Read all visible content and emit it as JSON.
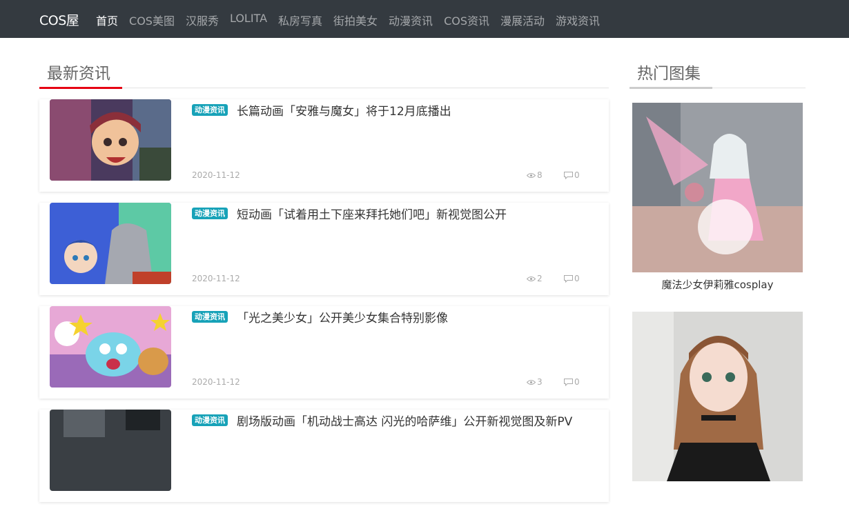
{
  "brand": "COS屋",
  "nav": [
    "首页",
    "COS美图",
    "汉服秀",
    "LOLITA",
    "私房写真",
    "街拍美女",
    "动漫资讯",
    "COS资讯",
    "漫展活动",
    "游戏资讯"
  ],
  "main": {
    "section_title": "最新资讯",
    "accent_color": "#e60012",
    "articles": [
      {
        "tag": "动漫资讯",
        "title": "长篇动画「安雅与魔女」将于12月底播出",
        "date": "2020-11-12",
        "views": "8",
        "comments": "0",
        "thumb_icon": "anime-girl-image"
      },
      {
        "tag": "动漫资讯",
        "title": "短动画「试着用土下座来拜托她们吧」新视觉图公开",
        "date": "2020-11-12",
        "views": "2",
        "comments": "0",
        "thumb_icon": "anime-girls-image"
      },
      {
        "tag": "动漫资讯",
        "title": "「光之美少女」公开美少女集合特别影像",
        "date": "2020-11-12",
        "views": "3",
        "comments": "0",
        "thumb_icon": "precure-mascots-image"
      },
      {
        "tag": "动漫资讯",
        "title": "剧场版动画「机动战士高达 闪光的哈萨维」公开新视觉图及新PV",
        "date": "",
        "views": "",
        "comments": "",
        "thumb_icon": "gundam-image"
      }
    ]
  },
  "side": {
    "section_title": "热门图集",
    "items": [
      {
        "caption": "魔法少女伊莉雅cosplay",
        "icon": "cosplay-photo"
      },
      {
        "caption": "",
        "icon": "cosplay-portrait-photo"
      }
    ]
  },
  "colors": {
    "navbar": "#343a40",
    "tag": "#17a2b8"
  }
}
